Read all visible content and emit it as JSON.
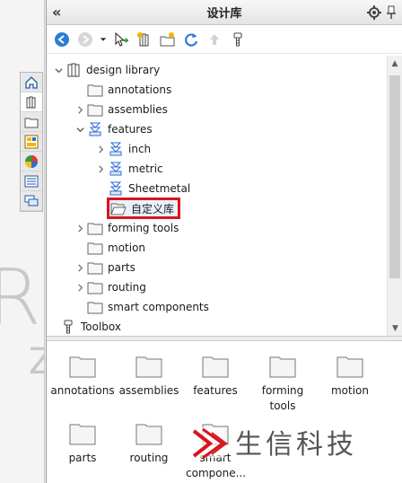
{
  "pane": {
    "title": "设计库"
  },
  "toolbar": [
    "back",
    "forward",
    "dropdown",
    "add-location",
    "add-library",
    "create-folder",
    "refresh",
    "up",
    "toolbox"
  ],
  "tree": {
    "items": [
      {
        "label": "design library",
        "level": 0,
        "expander": "expanded",
        "icon": "library-icon"
      },
      {
        "label": "annotations",
        "level": 1,
        "expander": "none",
        "icon": "folder-icon"
      },
      {
        "label": "assemblies",
        "level": 1,
        "expander": "collapsed",
        "icon": "folder-icon"
      },
      {
        "label": "features",
        "level": 1,
        "expander": "expanded",
        "icon": "feature-folder-icon"
      },
      {
        "label": "inch",
        "level": 2,
        "expander": "collapsed",
        "icon": "feature-folder-icon"
      },
      {
        "label": "metric",
        "level": 2,
        "expander": "collapsed",
        "icon": "feature-folder-icon"
      },
      {
        "label": "Sheetmetal",
        "level": 2,
        "expander": "none",
        "icon": "feature-folder-icon"
      },
      {
        "label": "自定义库",
        "level": 2,
        "expander": "none",
        "icon": "open-folder-icon",
        "highlight": true
      },
      {
        "label": "forming tools",
        "level": 1,
        "expander": "collapsed",
        "icon": "folder-icon"
      },
      {
        "label": "motion",
        "level": 1,
        "expander": "none",
        "icon": "folder-icon"
      },
      {
        "label": "parts",
        "level": 1,
        "expander": "collapsed",
        "icon": "folder-icon"
      },
      {
        "label": "routing",
        "level": 1,
        "expander": "collapsed",
        "icon": "folder-icon"
      },
      {
        "label": "smart components",
        "level": 1,
        "expander": "none",
        "icon": "folder-icon"
      },
      {
        "label": "Toolbox",
        "level": 0,
        "expander": "none",
        "icon": "toolbox-icon"
      }
    ]
  },
  "grid": {
    "items": [
      {
        "label": "annotations"
      },
      {
        "label": "assemblies"
      },
      {
        "label": "features"
      },
      {
        "label": "forming tools"
      },
      {
        "label": "motion"
      },
      {
        "label": "parts"
      },
      {
        "label": "routing"
      },
      {
        "label": "smart compone..."
      }
    ]
  },
  "watermark": {
    "text": "生信科技"
  },
  "colors": {
    "highlight_border": "#d9141c",
    "selection_bg": "#e8f1fb",
    "folder": "#f5f5f5",
    "accent_blue": "#1e73be"
  }
}
